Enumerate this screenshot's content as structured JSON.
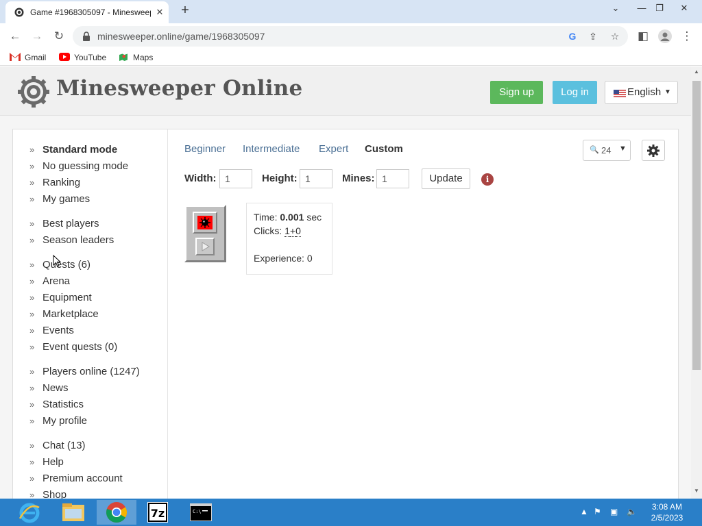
{
  "browser": {
    "tab_title": "Game #1968305097 - Minesweeper",
    "tab_close": "✕",
    "new_tab": "+",
    "url_host": "minesweeper.online",
    "url_path": "/game/1968305097",
    "bookmarks": [
      "Gmail",
      "YouTube",
      "Maps"
    ]
  },
  "header": {
    "site_title": "Minesweeper Online",
    "signup_label": "Sign up",
    "login_label": "Log in",
    "language_label": "English"
  },
  "sidebar": {
    "items": [
      {
        "label": "Standard mode"
      },
      {
        "label": "No guessing mode"
      },
      {
        "label": "Ranking"
      },
      {
        "label": "My games"
      },
      {
        "label": "Best players"
      },
      {
        "label": "Season leaders"
      },
      {
        "label": "Quests (6)"
      },
      {
        "label": "Arena"
      },
      {
        "label": "Equipment"
      },
      {
        "label": "Marketplace"
      },
      {
        "label": "Events"
      },
      {
        "label": "Event quests (0)"
      },
      {
        "label": "Players online (1247)"
      },
      {
        "label": "News"
      },
      {
        "label": "Statistics"
      },
      {
        "label": "My profile"
      },
      {
        "label": "Chat (13)"
      },
      {
        "label": "Help"
      },
      {
        "label": "Premium account"
      },
      {
        "label": "Shop"
      }
    ]
  },
  "levels": {
    "tabs": [
      "Beginner",
      "Intermediate",
      "Expert",
      "Custom"
    ],
    "active": "Custom"
  },
  "custom": {
    "width_label": "Width:",
    "width_value": "1",
    "height_label": "Height:",
    "height_value": "1",
    "mines_label": "Mines:",
    "mines_value": "1",
    "update_label": "Update"
  },
  "zoom": {
    "value": "24"
  },
  "stats": {
    "time_label": "Time:",
    "time_value": "0.001",
    "time_unit": "sec",
    "clicks_label": "Clicks:",
    "clicks_left": "1",
    "clicks_plus": "+",
    "clicks_right": "0",
    "experience_label": "Experience:",
    "experience_value": "0"
  },
  "taskbar": {
    "time": "3:08 AM",
    "date": "2/5/2023"
  },
  "colors": {
    "signup": "#5cb85c",
    "login": "#5bc0de",
    "link": "#4a6f94",
    "taskbar": "#2a7fc8",
    "info": "#a94442"
  }
}
